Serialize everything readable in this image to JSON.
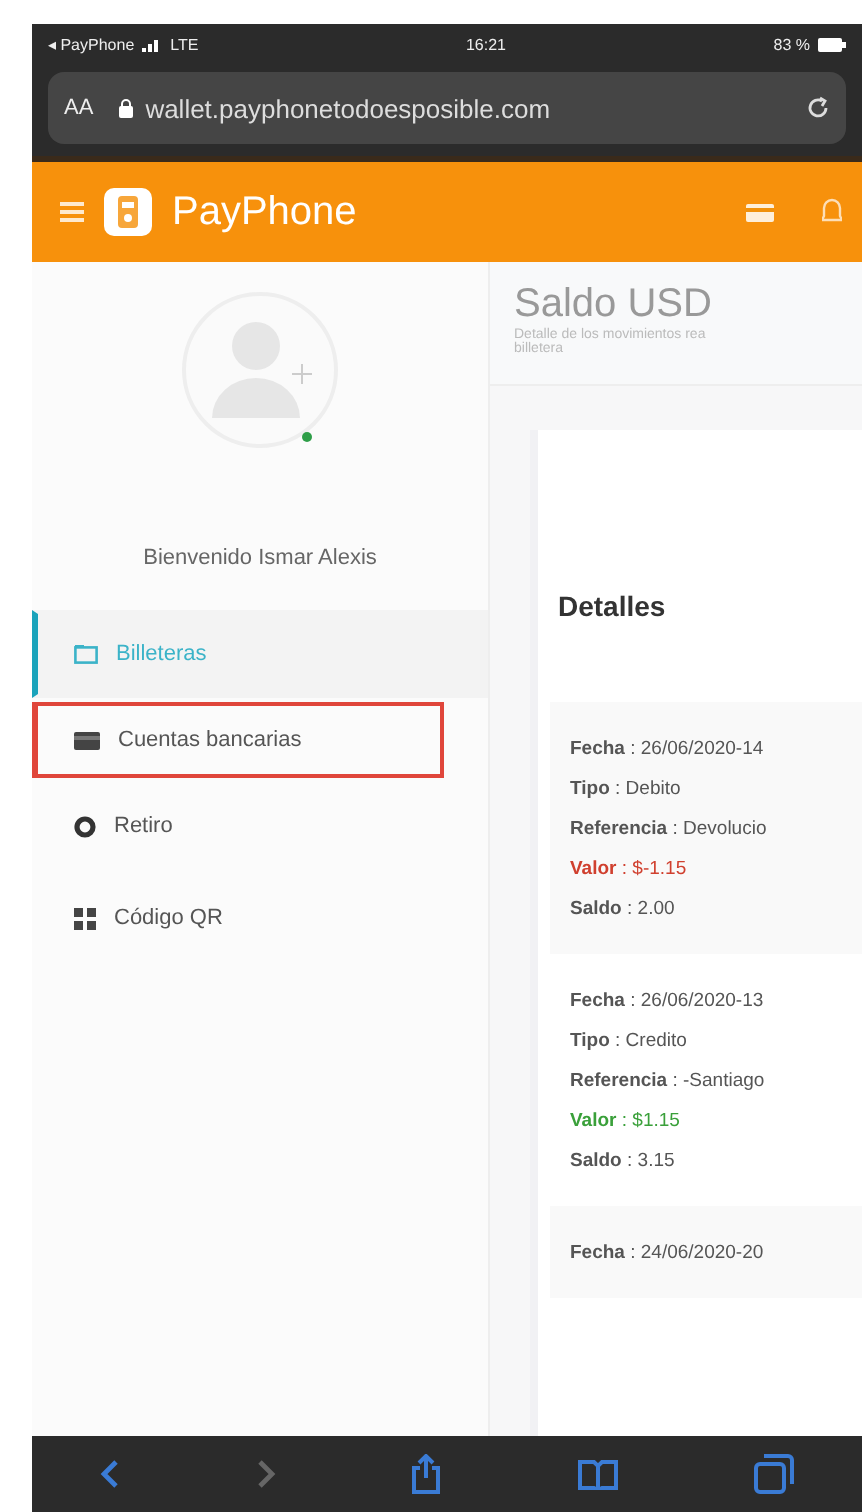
{
  "status_bar": {
    "carrier": "◂ PayPhone",
    "network": "LTE",
    "time": "16:21",
    "battery": "83 %"
  },
  "browser": {
    "text_size": "AA",
    "url": "wallet.payphonetodoesposible.com"
  },
  "header": {
    "brand": "PayPhone"
  },
  "profile": {
    "greeting": "Bienvenido Ismar Alexis",
    "online": true
  },
  "sidebar": {
    "items": [
      {
        "label": "Billeteras",
        "kind": "wallet",
        "selected": true,
        "highlighted": false
      },
      {
        "label": "Cuentas bancarias",
        "kind": "card",
        "selected": false,
        "highlighted": true
      },
      {
        "label": "Retiro",
        "kind": "withdraw",
        "selected": false,
        "highlighted": false
      },
      {
        "label": "Código QR",
        "kind": "qr",
        "selected": false,
        "highlighted": false
      }
    ]
  },
  "main": {
    "title": "Saldo USD",
    "subtitle": "Detalle de los movimientos rea",
    "subtitle_2": "billetera",
    "section": "Detalles",
    "transactions": [
      {
        "debit": true,
        "lines": [
          {
            "kind": "plain",
            "text": "**Fecha** : 26/06/2020-14"
          },
          {
            "kind": "plain",
            "text": "**Tipo** : Debito"
          },
          {
            "kind": "plain",
            "text": "**Referencia** : Devolucio"
          },
          {
            "kind": "amount",
            "text": "**Valor** : $-1.15"
          },
          {
            "kind": "plain",
            "text": "**Saldo** : 2.00"
          }
        ]
      },
      {
        "debit": false,
        "lines": [
          {
            "kind": "plain",
            "text": "**Fecha** : 26/06/2020-13"
          },
          {
            "kind": "plain",
            "text": "**Tipo** : Credito"
          },
          {
            "kind": "plain",
            "text": "**Referencia** : -Santiago"
          },
          {
            "kind": "amount",
            "text": "**Valor** : $1.15"
          },
          {
            "kind": "plain",
            "text": "**Saldo** : 3.15"
          }
        ]
      },
      {
        "lines": [
          {
            "kind": "plain",
            "text": "**Fecha** : 24/06/2020-20"
          }
        ]
      }
    ]
  },
  "toolbar": [
    {
      "kind": "back",
      "disabled": false
    },
    {
      "kind": "forward",
      "disabled": true
    },
    {
      "kind": "share",
      "disabled": false
    },
    {
      "kind": "bookmarks",
      "disabled": false
    },
    {
      "kind": "tabs",
      "disabled": false
    }
  ]
}
